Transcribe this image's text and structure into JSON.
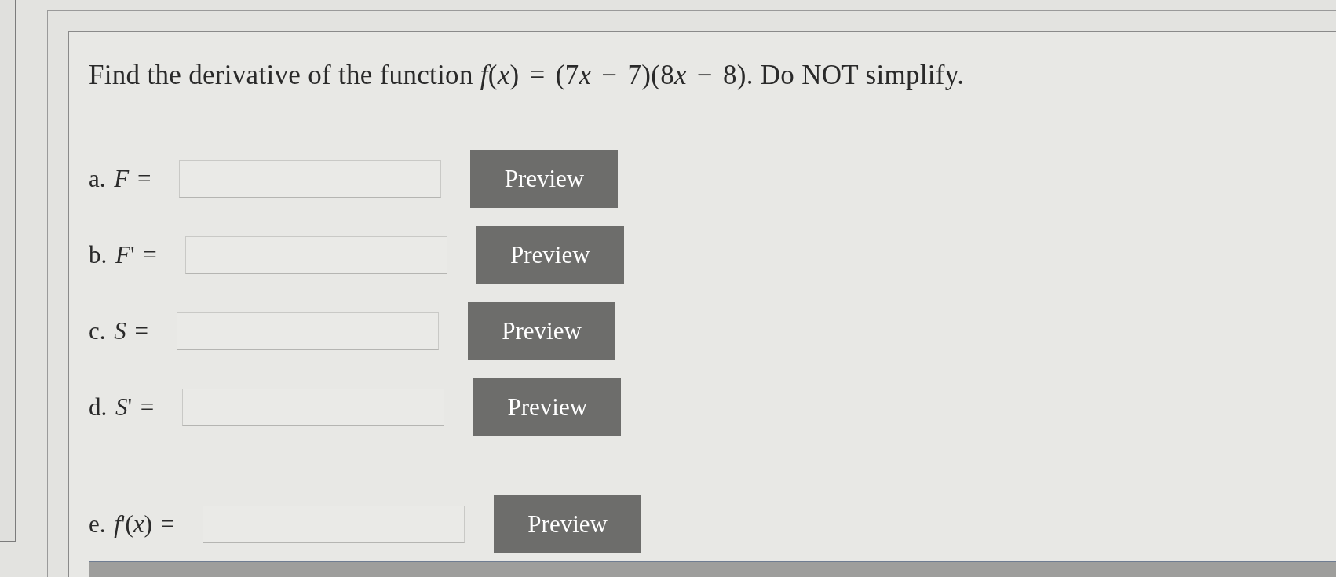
{
  "question": {
    "lead": "Find the derivative of the function",
    "formula": "f(x) = (7x − 7)(8x − 8)",
    "tail": ". Do NOT simplify."
  },
  "parts": [
    {
      "label": "a. *F* =",
      "button": "Preview"
    },
    {
      "label": "b. *F*' =",
      "button": "Preview"
    },
    {
      "label": "c. *S* =",
      "button": "Preview"
    },
    {
      "label": "d. *S*' =",
      "button": "Preview"
    }
  ],
  "final_answer": {
    "label": "e. *f*'(*x*) =",
    "button": "Preview"
  }
}
